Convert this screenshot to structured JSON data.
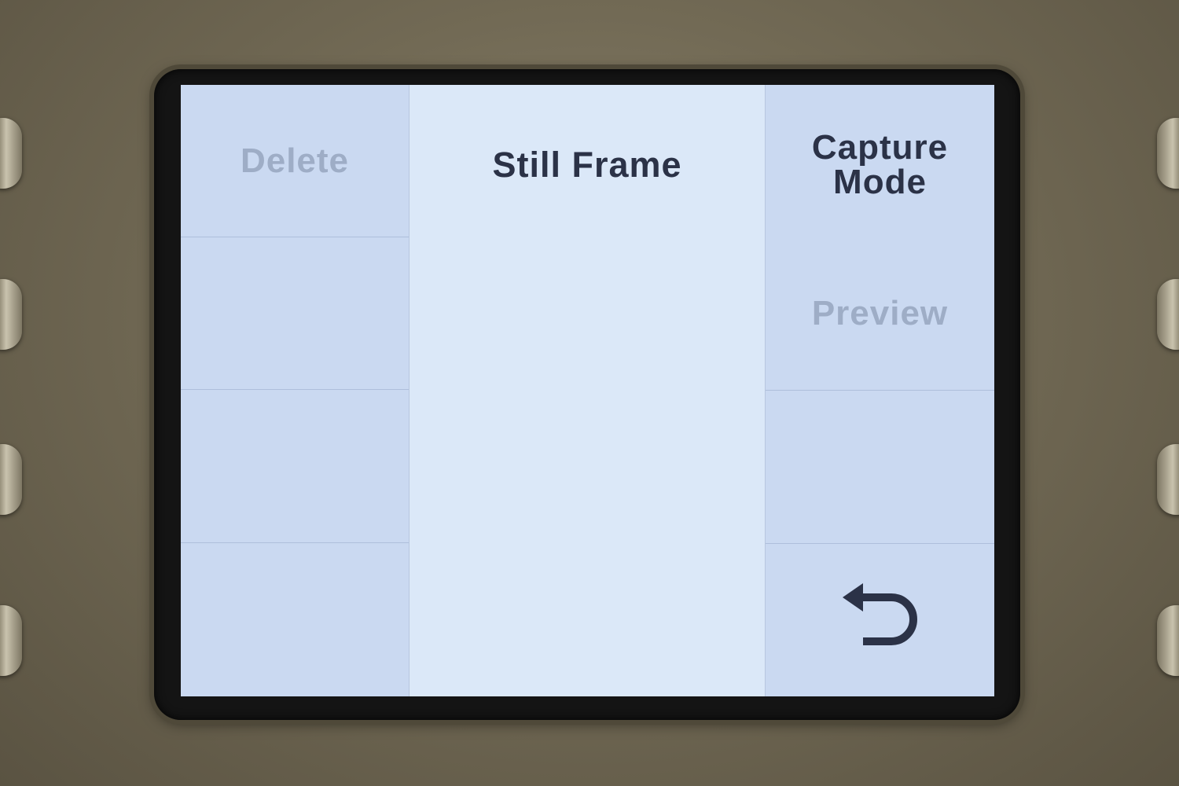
{
  "left_menu": {
    "items": [
      {
        "label": "Delete",
        "enabled": false
      },
      {
        "label": "",
        "enabled": false
      },
      {
        "label": "",
        "enabled": false
      },
      {
        "label": "",
        "enabled": false
      }
    ]
  },
  "center_panel": {
    "title": "Still Frame"
  },
  "right_menu": {
    "capture_mode": {
      "label_line1": "Capture",
      "label_line2": "Mode"
    },
    "preview": {
      "label": "Preview",
      "enabled": false
    },
    "back": {
      "icon": "back-arrow-icon"
    }
  },
  "colors": {
    "screen_bg": "#cad9f1",
    "center_bg": "#dbe8f8",
    "text_active": "#2b3247",
    "text_disabled": "#9eadc6"
  }
}
